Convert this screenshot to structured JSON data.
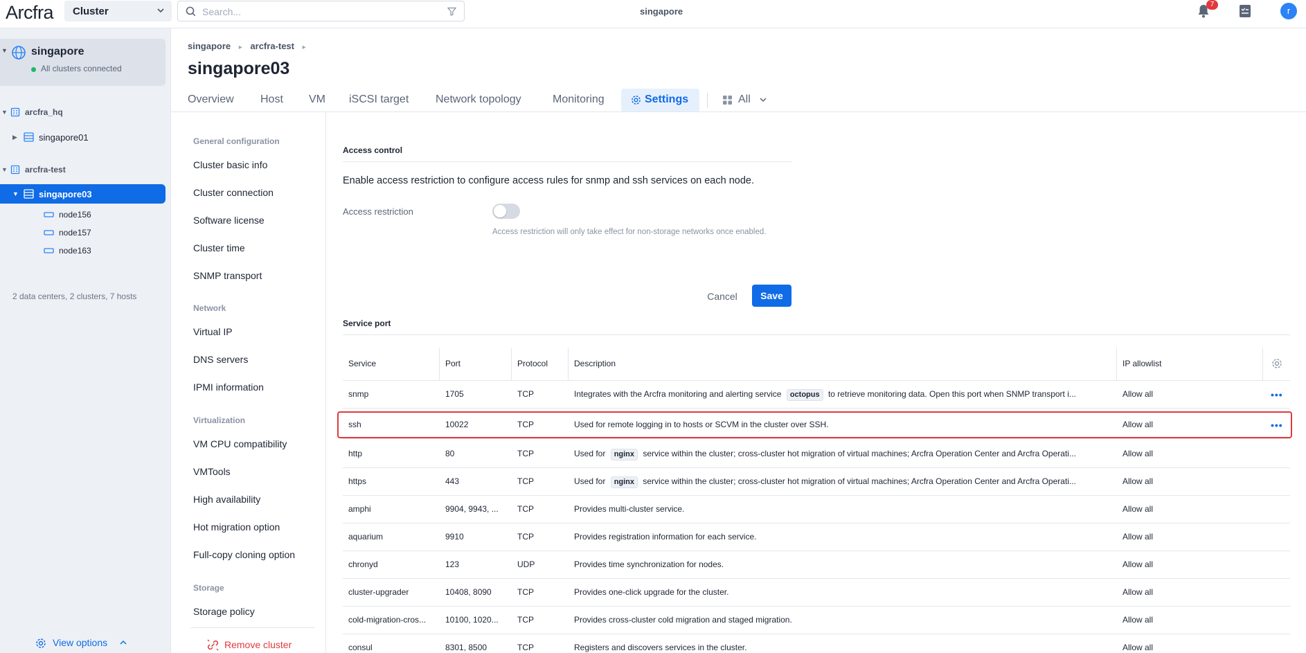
{
  "topbar": {
    "logo": "Arcfra",
    "cluster_select": "Cluster",
    "search_placeholder": "Search...",
    "center_title": "singapore",
    "notification_count": "7",
    "avatar_letter": "r"
  },
  "sidebar": {
    "datacenter": {
      "name": "singapore",
      "status": "All clusters connected"
    },
    "tree": [
      {
        "label": "arcfra_hq"
      },
      {
        "label": "singapore01"
      },
      {
        "label": "arcfra-test"
      },
      {
        "label": "singapore03"
      },
      {
        "label": "node156"
      },
      {
        "label": "node157"
      },
      {
        "label": "node163"
      }
    ],
    "summary": "2 data centers, 2 clusters, 7 hosts",
    "view_options": "View options"
  },
  "breadcrumb": {
    "items": [
      "singapore",
      "arcfra-test"
    ]
  },
  "page_title": "singapore03",
  "tabs": [
    "Overview",
    "Host",
    "VM",
    "iSCSI target",
    "Network topology",
    "Monitoring",
    "Settings"
  ],
  "tab_all": "All",
  "settings_nav": {
    "sections": [
      {
        "title": "General configuration",
        "items": [
          "Cluster basic info",
          "Cluster connection",
          "Software license",
          "Cluster time",
          "SNMP transport"
        ]
      },
      {
        "title": "Network",
        "items": [
          "Virtual IP",
          "DNS servers",
          "IPMI information"
        ]
      },
      {
        "title": "Virtualization",
        "items": [
          "VM CPU compatibility",
          "VMTools",
          "High availability",
          "Hot migration option",
          "Full-copy cloning option"
        ]
      },
      {
        "title": "Storage",
        "items": [
          "Storage policy"
        ]
      }
    ],
    "remove_cluster": "Remove cluster"
  },
  "access_control": {
    "title": "Access control",
    "description": "Enable access restriction to configure access rules for snmp and ssh services on each node.",
    "label": "Access restriction",
    "enabled": false,
    "hint": "Access restriction will only take effect for non-storage networks once enabled.",
    "cancel": "Cancel",
    "save": "Save"
  },
  "service_port": {
    "title": "Service port",
    "columns": [
      "Service",
      "Port",
      "Protocol",
      "Description",
      "IP allowlist"
    ],
    "rows": [
      {
        "service": "snmp",
        "port": "1705",
        "protocol": "TCP",
        "desc_pre": "Integrates with the Arcfra monitoring and alerting service ",
        "code": "octopus",
        "desc_post": " to retrieve monitoring data. Open this port when SNMP transport i...",
        "allow": "Allow all",
        "more": true
      },
      {
        "service": "ssh",
        "port": "10022",
        "protocol": "TCP",
        "desc_pre": "Used for remote logging in to hosts or SCVM in the cluster over SSH.",
        "code": "",
        "desc_post": "",
        "allow": "Allow all",
        "more": true
      },
      {
        "service": "http",
        "port": "80",
        "protocol": "TCP",
        "desc_pre": "Used for ",
        "code": "nginx",
        "desc_post": " service within the cluster; cross-cluster hot migration of virtual machines; Arcfra Operation Center and Arcfra Operati...",
        "allow": "Allow all",
        "more": false
      },
      {
        "service": "https",
        "port": "443",
        "protocol": "TCP",
        "desc_pre": "Used for ",
        "code": "nginx",
        "desc_post": " service within the cluster; cross-cluster hot migration of virtual machines; Arcfra Operation Center and Arcfra Operati...",
        "allow": "Allow all",
        "more": false
      },
      {
        "service": "amphi",
        "port": "9904, 9943, ...",
        "protocol": "TCP",
        "desc_pre": "Provides multi-cluster service.",
        "code": "",
        "desc_post": "",
        "allow": "Allow all",
        "more": false
      },
      {
        "service": "aquarium",
        "port": "9910",
        "protocol": "TCP",
        "desc_pre": "Provides registration information for each service.",
        "code": "",
        "desc_post": "",
        "allow": "Allow all",
        "more": false
      },
      {
        "service": "chronyd",
        "port": "123",
        "protocol": "UDP",
        "desc_pre": "Provides time synchronization for nodes.",
        "code": "",
        "desc_post": "",
        "allow": "Allow all",
        "more": false
      },
      {
        "service": "cluster-upgrader",
        "port": "10408, 8090",
        "protocol": "TCP",
        "desc_pre": "Provides one-click upgrade for the cluster.",
        "code": "",
        "desc_post": "",
        "allow": "Allow all",
        "more": false
      },
      {
        "service": "cold-migration-cros...",
        "port": "10100, 1020...",
        "protocol": "TCP",
        "desc_pre": "Provides cross-cluster cold migration and staged migration.",
        "code": "",
        "desc_post": "",
        "allow": "Allow all",
        "more": false
      },
      {
        "service": "consul",
        "port": "8301, 8500",
        "protocol": "TCP",
        "desc_pre": "Registers and discovers services in the cluster.",
        "code": "",
        "desc_post": "",
        "allow": "Allow all",
        "more": false
      }
    ]
  },
  "colors": {
    "accent": "#0f6be6",
    "danger": "#e0393e",
    "success": "#1fb868"
  }
}
